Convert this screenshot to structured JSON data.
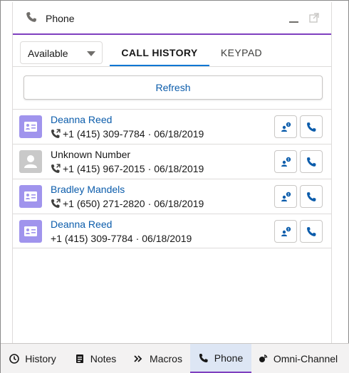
{
  "panel": {
    "title": "Phone",
    "accent": "#7f3fbf"
  },
  "status": {
    "selected": "Available"
  },
  "tabs": [
    {
      "label": "CALL HISTORY",
      "active": true
    },
    {
      "label": "KEYPAD",
      "active": false
    }
  ],
  "refresh_label": "Refresh",
  "calls": [
    {
      "name": "Deanna Reed",
      "number": "+1 (415) 309-7784",
      "date": "06/18/2019",
      "contact": true,
      "call_icon": true
    },
    {
      "name": "Unknown Number",
      "number": "+1 (415) 967-2015",
      "date": "06/18/2019",
      "contact": false,
      "call_icon": true
    },
    {
      "name": "Bradley Mandels",
      "number": "+1 (650) 271-2820",
      "date": "06/18/2019",
      "contact": true,
      "call_icon": true
    },
    {
      "name": "Deanna Reed",
      "number": "+1 (415) 309-7784",
      "date": "06/18/2019",
      "contact": true,
      "call_icon": false
    }
  ],
  "separator": "·",
  "utility_bar": [
    {
      "label": "History",
      "icon": "clock-icon",
      "active": false
    },
    {
      "label": "Notes",
      "icon": "notes-icon",
      "active": false
    },
    {
      "label": "Macros",
      "icon": "macros-icon",
      "active": false
    },
    {
      "label": "Phone",
      "icon": "phone-icon",
      "active": true
    },
    {
      "label": "Omni-Channel",
      "icon": "omni-channel-icon",
      "active": false
    }
  ]
}
